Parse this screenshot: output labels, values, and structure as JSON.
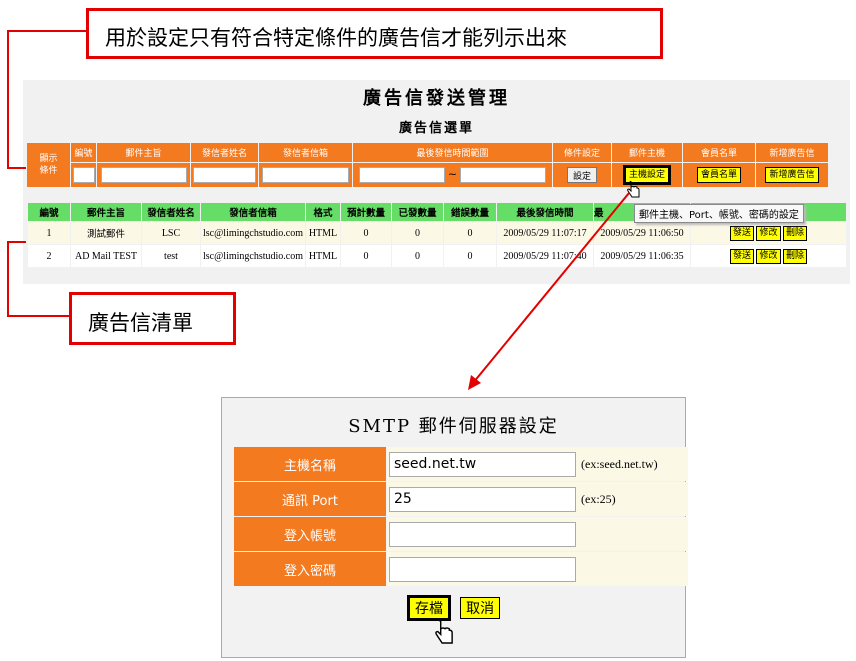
{
  "callouts": {
    "top": "用於設定只有符合特定條件的廣告信才能列示出來",
    "bottom": "廣告信清單"
  },
  "panel": {
    "title": "廣告信發送管理",
    "subtitle": "廣告信選單"
  },
  "filter": {
    "row_label": "顯示條件",
    "headers": [
      "編號",
      "郵件主旨",
      "發信者姓名",
      "發信者信箱",
      "最後發信時間範圍",
      "條件設定",
      "郵件主機",
      "會員名單",
      "新增廣告信"
    ],
    "range_sep": "~",
    "set_button": "設定",
    "host_button": "主機設定",
    "members_button": "會員名單",
    "new_button": "新增廣告信"
  },
  "tooltip": "郵件主機、Port、帳號、密碼的設定",
  "list": {
    "headers": [
      "編號",
      "郵件主旨",
      "發信者姓名",
      "發信者信箱",
      "格式",
      "預計數量",
      "已發數量",
      "錯誤數量",
      "最後發信時間",
      "最"
    ],
    "rows": [
      {
        "id": "1",
        "subject": "測試郵件",
        "name": "LSC",
        "email": "lsc@limingchstudio.com",
        "format": "HTML",
        "planned": "0",
        "sent": "0",
        "errors": "0",
        "last_sent": "2009/05/29 11:07:17",
        "created": "2009/05/29 11:06:50"
      },
      {
        "id": "2",
        "subject": "AD Mail TEST",
        "name": "test",
        "email": "lsc@limingchstudio.com",
        "format": "HTML",
        "planned": "0",
        "sent": "0",
        "errors": "0",
        "last_sent": "2009/05/29 11:07:40",
        "created": "2009/05/29 11:06:35"
      }
    ],
    "send_label": "發送",
    "edit_label": "修改",
    "delete_label": "刪除"
  },
  "smtp": {
    "title": "SMTP 郵件伺服器設定",
    "host_label": "主機名稱",
    "host_value": "seed.net.tw",
    "host_example": "(ex:seed.net.tw)",
    "port_label": "通訊 Port",
    "port_value": "25",
    "port_example": "(ex:25)",
    "account_label": "登入帳號",
    "account_value": "",
    "password_label": "登入密碼",
    "password_value": "",
    "save_button": "存檔",
    "cancel_button": "取消"
  },
  "colors": {
    "callout_border": "#e30000",
    "header_orange": "#f47a20",
    "list_header_green": "#66dd66",
    "button_yellow": "#ffff00",
    "arrow_red": "#e30000"
  }
}
